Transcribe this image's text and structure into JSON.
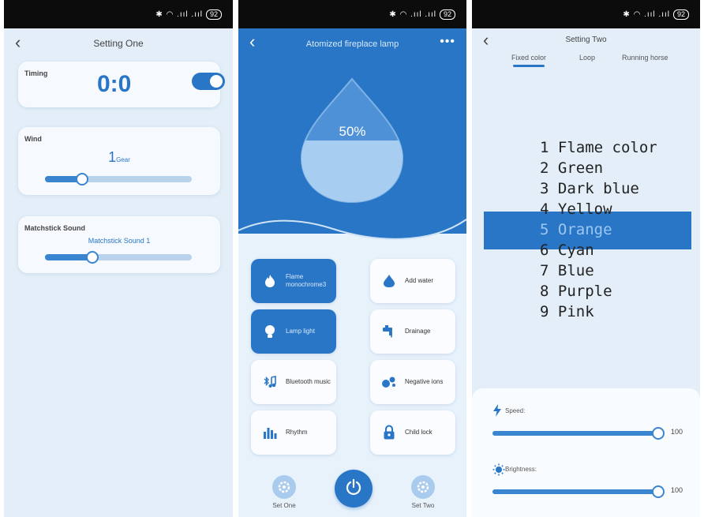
{
  "status_bar": {
    "icons": "✱ ◠ .ııl .ııl",
    "battery": "92"
  },
  "panel1": {
    "title": "Setting One",
    "timing": {
      "label": "Timing",
      "value": "0:0",
      "enabled": true
    },
    "wind": {
      "label": "Wind",
      "value": "1",
      "unit": "Gear",
      "level": 0.25
    },
    "matchstick": {
      "label": "Matchstick Sound",
      "value": "Matchstick Sound 1",
      "level": 0.32
    }
  },
  "panel2": {
    "title": "Atomized fireplace lamp",
    "more": "•••",
    "water_level": "50%",
    "water_fraction": 0.5,
    "functions": [
      {
        "label": "Flame monochrome3",
        "icon": "flame-icon",
        "active": true
      },
      {
        "label": "Add water",
        "icon": "water-drop-icon",
        "active": false
      },
      {
        "label": "Lamp light",
        "icon": "bulb-icon",
        "active": true
      },
      {
        "label": "Drainage",
        "icon": "faucet-icon",
        "active": false
      },
      {
        "label": "Bluetooth music",
        "icon": "bluetooth-music-icon",
        "active": false
      },
      {
        "label": "Negative ions",
        "icon": "ions-icon",
        "active": false
      },
      {
        "label": "Rhythm",
        "icon": "equalizer-icon",
        "active": false
      },
      {
        "label": "Child lock",
        "icon": "lock-icon",
        "active": false
      }
    ],
    "set_one": "Set One",
    "set_two": "Set Two"
  },
  "panel3": {
    "title": "Setting Two",
    "tabs": [
      "Fixed color",
      "Loop",
      "Running horse"
    ],
    "active_tab": 0,
    "colors": [
      "1 Flame color",
      "2 Green",
      "3 Dark blue",
      "4 Yellow",
      "5 Orange",
      "6 Cyan",
      "7 Blue",
      "8 Purple",
      "9 Pink"
    ],
    "selected_index": 4,
    "speed": {
      "label": "Speed:",
      "value": "100",
      "level": 1.0
    },
    "brightness": {
      "label": "Brightness:",
      "value": "100",
      "level": 1.0
    }
  },
  "colors": {
    "accent": "#2a76c6",
    "track": "#b9d3ec",
    "background": "#e3eef8"
  }
}
